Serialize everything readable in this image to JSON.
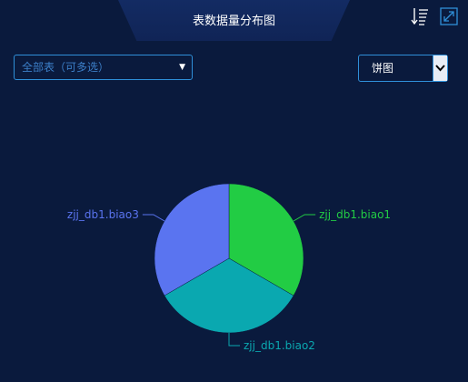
{
  "header": {
    "title": "表数据量分布图"
  },
  "toolbar": {
    "sort_icon": "sort-descending-icon",
    "expand_icon": "expand-icon"
  },
  "filters": {
    "table_select": {
      "value": "全部表（可多选）"
    },
    "chart_type_select": {
      "value": "饼图"
    }
  },
  "colors": {
    "background": "#0a1a3d",
    "accent_border": "#2f8fd8"
  },
  "chart_data": {
    "type": "pie",
    "categories": [
      "zjj_db1.biao1",
      "zjj_db1.biao2",
      "zjj_db1.biao3"
    ],
    "values": [
      1,
      1,
      1
    ],
    "colors": [
      "#22cc44",
      "#0aa8b0",
      "#5a74f0"
    ]
  }
}
